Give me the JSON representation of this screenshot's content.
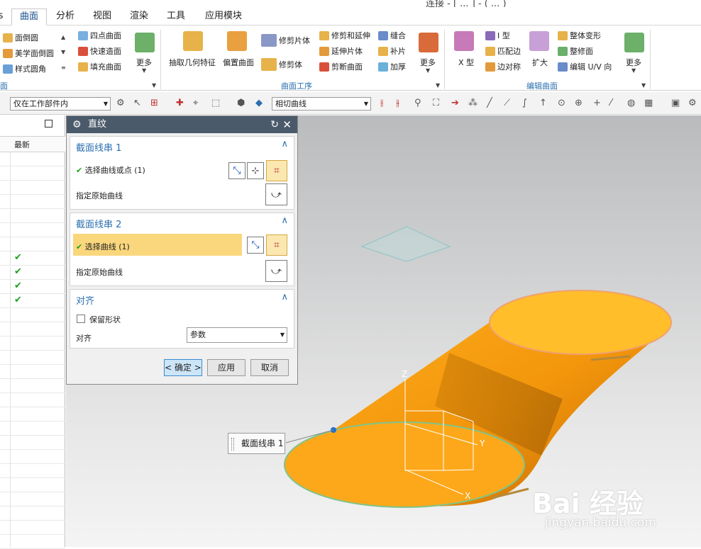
{
  "window": {
    "title": "连接 - [ ... ] - ( ... )"
  },
  "tabs": [
    "s",
    "曲面",
    "分析",
    "视图",
    "渲染",
    "工具",
    "应用模块"
  ],
  "active_tab": "曲面",
  "ribbon": {
    "small_col1": [
      "面倒圆",
      "美学面倒圆",
      "样式圆角"
    ],
    "small_col2": [
      "四点曲面",
      "快速造面",
      "填充曲面"
    ],
    "more1": "更多",
    "group1": "面",
    "big_extract": "抽取几何特征",
    "big_offset": "偏置曲面",
    "mid_col1": [
      "修剪片体",
      "修剪体"
    ],
    "mid_col2": [
      "修剪和延伸",
      "延伸片体",
      "剪断曲面"
    ],
    "mid_col3": [
      "缝合",
      "补片",
      "加厚"
    ],
    "more2": "更多",
    "group2": "曲面工序",
    "big_xtype": "X 型",
    "right_col1": [
      "I 型",
      "匹配边",
      "边对称"
    ],
    "big_expand": "扩大",
    "right_col2": [
      "整体变形",
      "整修面",
      "编辑 U/V 向"
    ],
    "more3": "更多",
    "group3": "编辑曲面"
  },
  "toolbar2": {
    "filter": "仅在工作部件内",
    "curve_rule": "相切曲线"
  },
  "left_panel": {
    "column_header": "最新",
    "checked_rows": [
      7,
      8,
      9,
      10
    ]
  },
  "dialog": {
    "title": "直纹",
    "section1": {
      "title": "截面线串 1",
      "select_label": "选择曲线或点 (1)",
      "origin_label": "指定原始曲线"
    },
    "section2": {
      "title": "截面线串 2",
      "select_label": "选择曲线 (1)",
      "origin_label": "指定原始曲线"
    },
    "section3": {
      "title": "对齐",
      "keep_shape": "保留形状",
      "align_label": "对齐",
      "align_value": "参数"
    },
    "ok": "< 确定 >",
    "apply": "应用",
    "cancel": "取消"
  },
  "viewport": {
    "callout": "截面线串 1",
    "axis_labels": {
      "z": "Z",
      "y": "Y",
      "x": "X"
    },
    "surface_color": "#f7a21a",
    "top_face_color": "#ffbe2a"
  },
  "watermark": {
    "brand": "Bai 经验",
    "url": "jingyan.baidu.com"
  },
  "colors": {
    "accent": "#2a6fb0",
    "highlight": "#fad77d",
    "check": "#1ea11e"
  }
}
